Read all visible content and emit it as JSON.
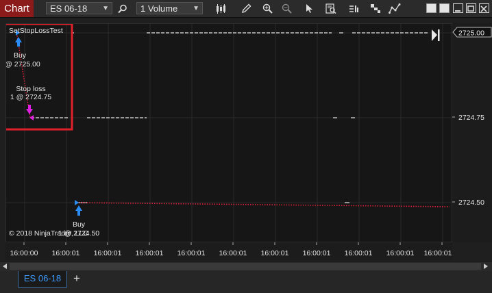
{
  "toolbar": {
    "chart_tab": "Chart",
    "instrument": "ES 06-18",
    "interval": "1 Volume"
  },
  "chart": {
    "strategy_label": "SetStopLossTest",
    "annotations": {
      "buy1": "Buy",
      "buy1_price": "@ 2725.00",
      "stop_loss": "Stop loss",
      "stop_loss_price": "1 @ 2724.75",
      "buy2": "Buy",
      "buy2_price": "1 @ 2724.50"
    },
    "copyright": "© 2018 NinjaTrader, LLC",
    "y_ticks": [
      "2724.75",
      "2724.50"
    ],
    "price_marker": "2725.00",
    "x_ticks": [
      "16:00:00",
      "16:00:01",
      "16:00:01",
      "16:00:01",
      "16:00:01",
      "16:00:01",
      "16:00:01",
      "16:00:01",
      "16:00:01",
      "16:00:01",
      "16:00:01"
    ]
  },
  "tabs": {
    "active": "ES 06-18",
    "add": "+"
  },
  "colors": {
    "chart_tab": "#8b1a1a",
    "highlight_box": "#e0202a",
    "buy_arrow": "#2b8cf5",
    "stop_arrow": "#e020e0",
    "trade_line": "#e0203a"
  }
}
